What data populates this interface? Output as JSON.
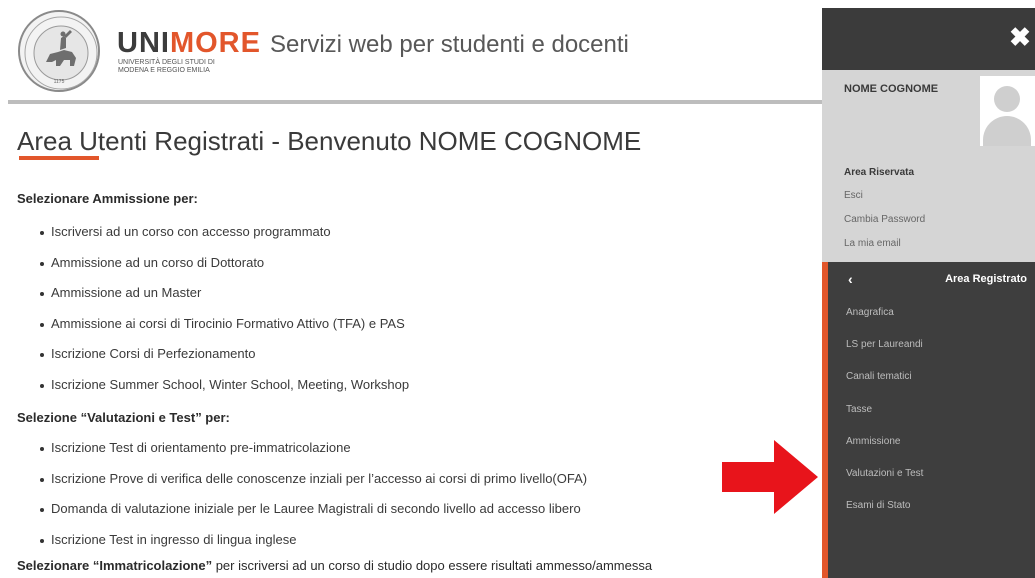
{
  "header": {
    "brand_uni": "UNI",
    "brand_more": "MORE",
    "brand_sub_line1": "UNIVERSITÀ DEGLI STUDI DI",
    "brand_sub_line2": "MODENA E REGGIO EMILIA",
    "tagline": "Servizi web per studenti e docenti",
    "seal_year": "1175"
  },
  "main": {
    "title": "Area Utenti Registrati - Benvenuto NOME COGNOME",
    "section1": {
      "heading": "Selezionare Ammissione per:",
      "items": [
        "Iscriversi ad un corso con accesso programmato",
        "Ammissione ad un corso di Dottorato",
        "Ammissione ad un Master",
        "Ammissione ai corsi di Tirocinio Formativo Attivo (TFA) e PAS",
        "Iscrizione Corsi di Perfezionamento",
        "Iscrizione Summer School, Winter School, Meeting, Workshop"
      ]
    },
    "section2": {
      "heading": "Selezione “Valutazioni e Test” per:",
      "items": [
        "Iscrizione Test di orientamento pre-immatricolazione",
        "Iscrizione Prove di verifica delle conoscenze inziali per l’accesso ai corsi di primo livello(OFA)",
        "Domanda di valutazione iniziale per le Lauree Magistrali di secondo livello ad accesso libero",
        "Iscrizione Test in ingresso di lingua inglese"
      ]
    },
    "bottom_bold": "Selezionare “Immatricolazione”",
    "bottom_text": " per iscriversi ad un corso di studio dopo essere risultati ammesso/ammessa"
  },
  "panel": {
    "close_icon": "✖",
    "user_name": "NOME COGNOME",
    "reserved": {
      "title": "Area Riservata",
      "links": [
        "Esci",
        "Cambia Password",
        "La mia email"
      ]
    },
    "menu": {
      "back_icon": "‹",
      "header": "Area Registrato",
      "items": [
        "Anagrafica",
        "LS per Laureandi",
        "Canali tematici",
        "Tasse",
        "Ammissione",
        "Valutazioni e Test",
        "Esami di Stato"
      ]
    }
  },
  "colors": {
    "accent": "#e2562b",
    "arrow": "#e8141b",
    "panel_dark": "#3e3e3e",
    "panel_light": "#d5d5d5"
  }
}
